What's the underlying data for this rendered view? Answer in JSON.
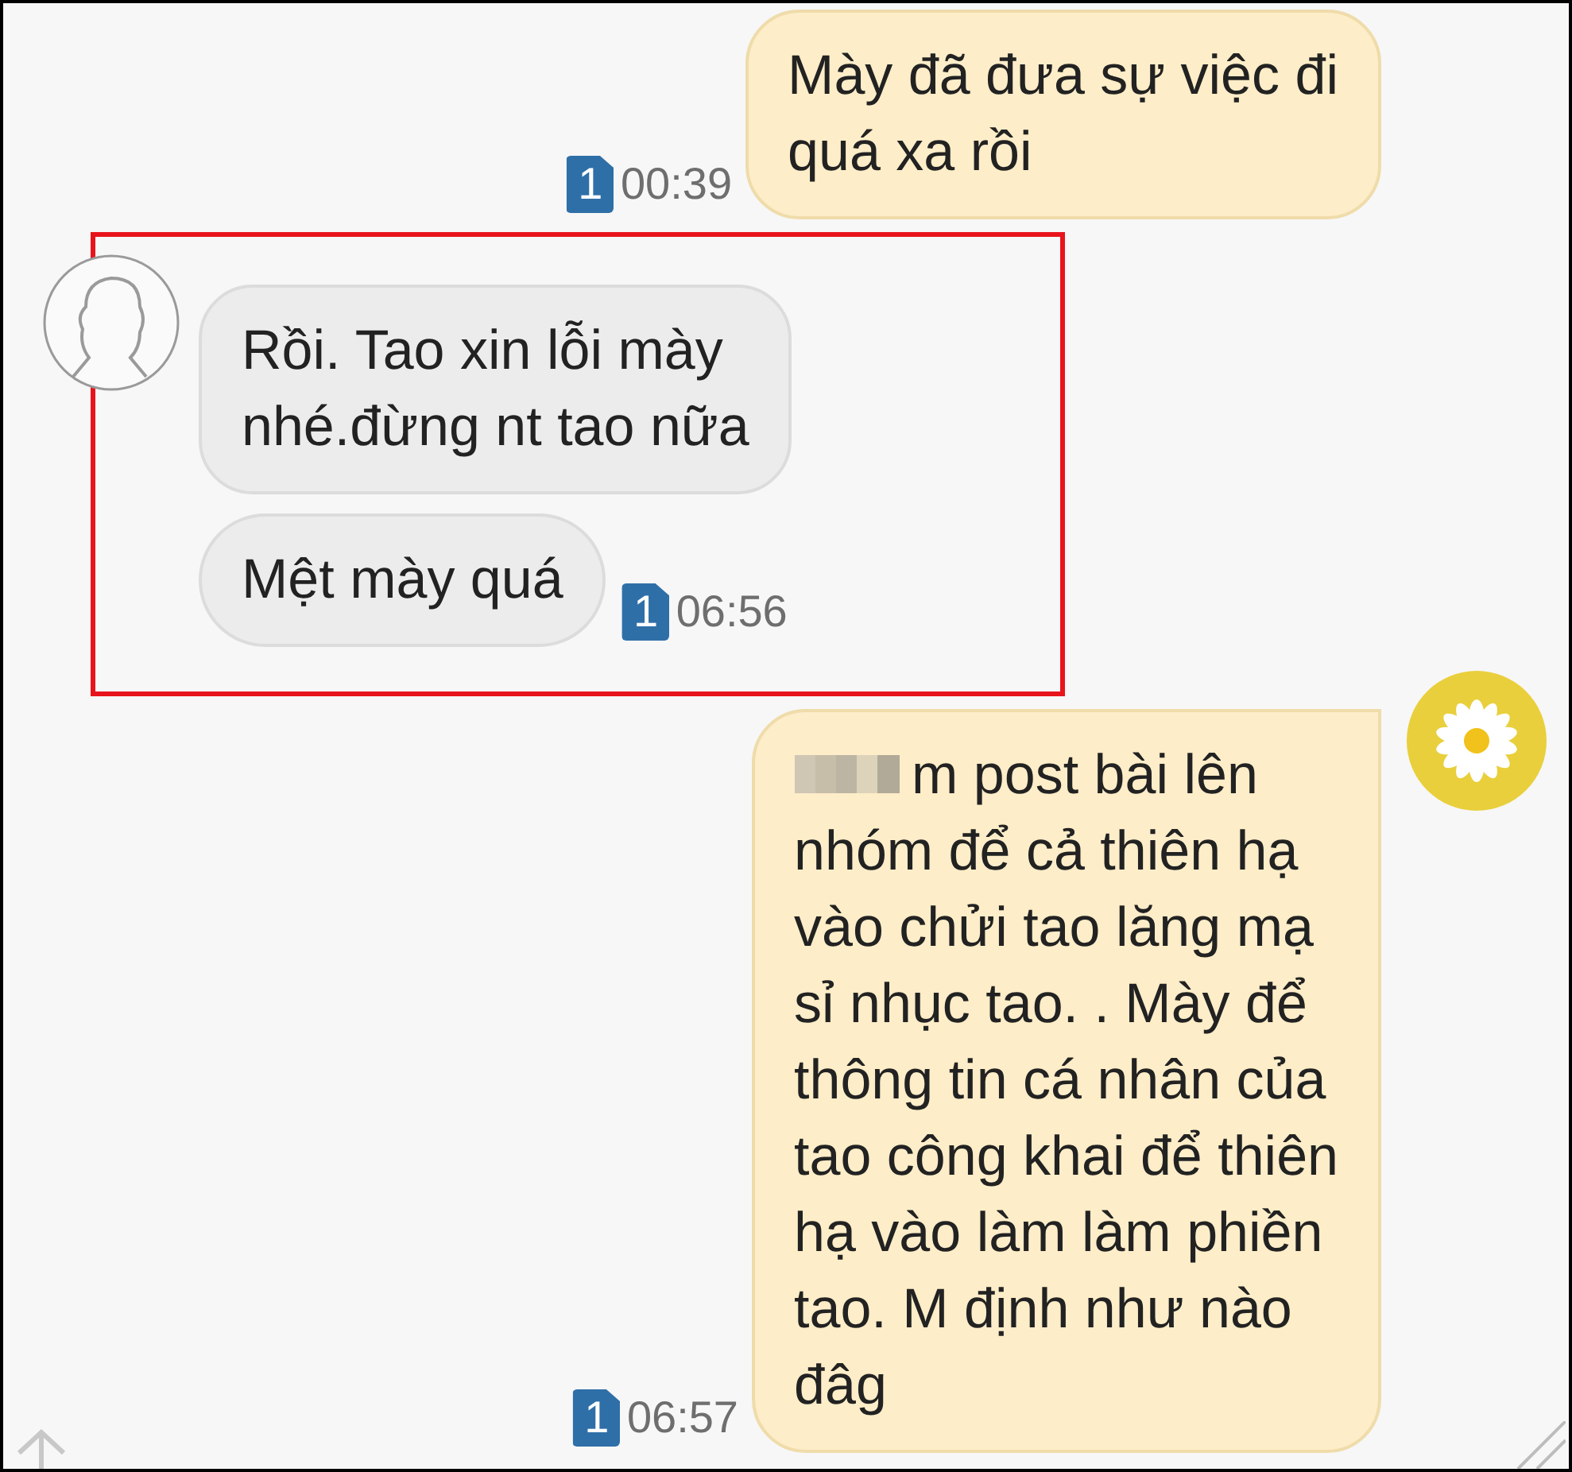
{
  "conversation": [
    {
      "kind": "sent",
      "highlighted": false,
      "avatar": false,
      "sim": "1",
      "time": "00:39",
      "bubbles": [
        {
          "redacted_prefix": false,
          "lines": [
            "Mày đã đưa sự việc đi",
            "quá xa rồi"
          ]
        }
      ]
    },
    {
      "kind": "received",
      "highlighted": true,
      "avatar": true,
      "sim": "1",
      "time": "06:56",
      "bubbles": [
        {
          "redacted_prefix": false,
          "lines": [
            "Rồi. Tao xin lỗi mày",
            "nhé.đừng nt tao nữa"
          ]
        },
        {
          "redacted_prefix": false,
          "lines": [
            "Mệt mày quá"
          ]
        }
      ]
    },
    {
      "kind": "sent",
      "highlighted": false,
      "avatar": true,
      "sim": "1",
      "time": "06:57",
      "bubbles": [
        {
          "redacted_prefix": true,
          "lines": [
            "m post bài lên",
            "nhóm để cả  thiên hạ",
            "vào chửi tao lăng mạ",
            "sỉ nhục tao. . Mày để",
            "thông tin cá nhân của",
            "tao công khai để thiên",
            "hạ vào làm làm phiền",
            "tao. M định như nào",
            "đâg"
          ]
        }
      ]
    }
  ]
}
